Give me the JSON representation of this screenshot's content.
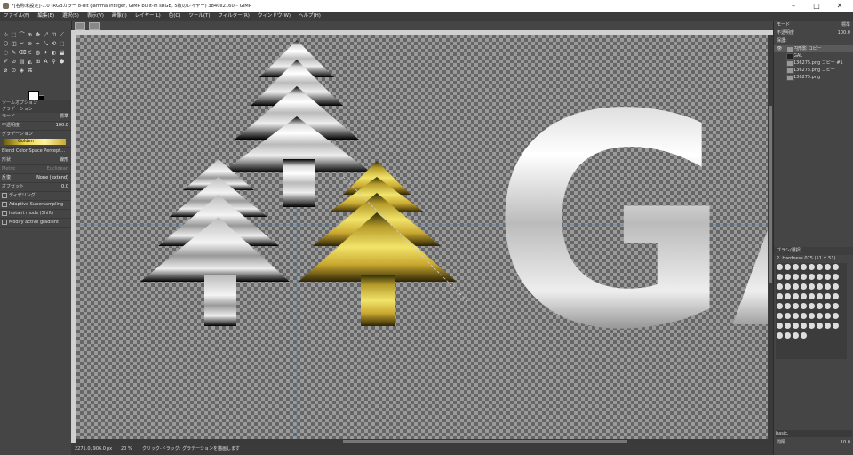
{
  "window": {
    "title": "*[名称未設定]-1.0 (RGBカラー 8-bit gamma integer, GIMP built-in sRGB, 5枚のレイヤー) 3840x2160 – GIMP",
    "minimize": "–",
    "maximize": "□",
    "close": "✕"
  },
  "menubar": [
    "ファイル(F)",
    "編集(E)",
    "選択(S)",
    "表示(V)",
    "画像(I)",
    "レイヤー(L)",
    "色(C)",
    "ツール(T)",
    "フィルター(R)",
    "ウィンドウ(W)",
    "ヘルプ(H)"
  ],
  "toolbox": {
    "tools": [
      "⊹",
      "⬚",
      "⌒",
      "⊕",
      "✥",
      "⤢",
      "⊡",
      "⟋",
      "⬡",
      "◫",
      "✂",
      "⊗",
      "⌖",
      "⤡",
      "⟲",
      "⬚",
      "◌",
      "✎",
      "⌫",
      "⚟",
      "◍",
      "✦",
      "◐",
      "⬓",
      "✐",
      "⊘",
      "▤",
      "◭",
      "⊞",
      "A",
      "⚲",
      "⬢",
      "⌀",
      "⊙",
      "◈",
      "⌘"
    ],
    "options_header": "ツールオプション",
    "tool_name": "グラデーション",
    "mode_label": "モード",
    "mode_value": "標準",
    "opacity_label": "不透明度",
    "opacity_value": "100.0",
    "gradient_label": "グラデーション",
    "gradient_value": "Golden",
    "blend_space": "Blend Color Space Percept…",
    "shape_label": "形状",
    "shape_value": "線形",
    "metric_label": "Metric",
    "metric_value": "Euclidean",
    "repeat_label": "反復",
    "repeat_value": "None (extend)",
    "offset_label": "オフセット",
    "offset_value": "0.0",
    "dither_label": "ディザリング",
    "adaptive": "Adaptive Supersampling",
    "instant": "Instant mode (Shift)",
    "modify": "Modify active gradient"
  },
  "rightpanel": {
    "mode_label": "モード",
    "mode_value": "標準",
    "opacity_label": "不透明度",
    "opacity_value": "100.0",
    "lock_label": "保護:",
    "layers": [
      {
        "name": "円形影 コピー",
        "selected": true
      },
      {
        "name": "GAL",
        "selected": false
      },
      {
        "name": "136275.png コピー #1",
        "selected": false
      },
      {
        "name": "136275.png コピー",
        "selected": false
      },
      {
        "name": "136275.png",
        "selected": false
      }
    ],
    "brush_panel_label": "ブラシ/選択",
    "brush_name": "2. Hardness 075 (51 × 51)",
    "brush_tag": "basic,",
    "spacing_label": "間隔",
    "spacing_value": "10.0"
  },
  "status": {
    "coords": "2271.0, 906.0",
    "unit": "px",
    "zoom": "20 %",
    "message": "クリック-ドラッグ: グラデーションを描画します"
  },
  "canvas": {
    "big_text": "GA"
  },
  "colors": {
    "fg": "#ffffff",
    "bg": "#000000",
    "gold": "#e8d24a"
  }
}
